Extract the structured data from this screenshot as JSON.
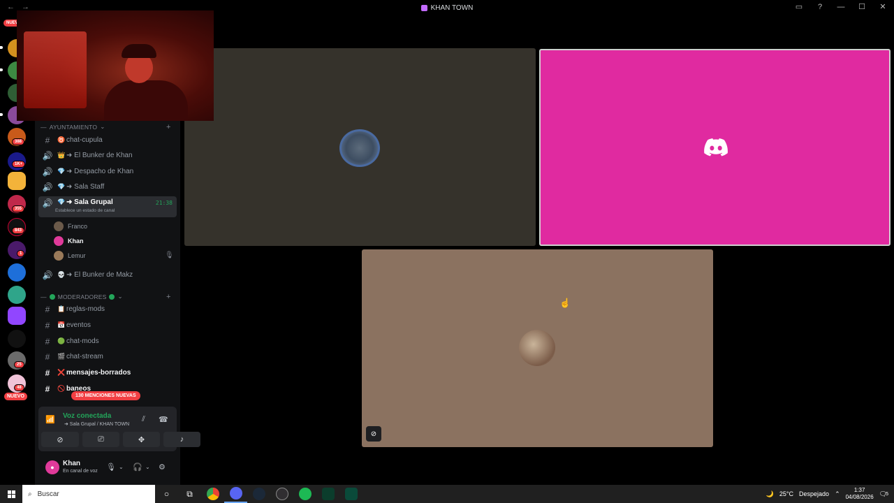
{
  "window": {
    "title": "KHAN TOWN",
    "nav_back": "←",
    "nav_forward": "→"
  },
  "server_rail": {
    "new_badge_top": "NUEVO",
    "new_badge_bottom": "NUEVO",
    "badges": [
      "388",
      "1K+",
      "355",
      "843",
      "1",
      "25",
      "48"
    ]
  },
  "sidebar": {
    "categories": {
      "ayuntamiento": "AYUNTAMIENTO",
      "moderadores": "MODERADORES"
    },
    "channels": [
      {
        "name": "chat-cupula",
        "prefix": "#",
        "emoji": "♉"
      },
      {
        "name": "➜ El Bunker de Khan",
        "prefix": "🔊",
        "emoji": "👑"
      },
      {
        "name": "➜ Despacho de Khan",
        "prefix": "🔊",
        "emoji": "💎"
      },
      {
        "name": "➜ Sala Staff",
        "prefix": "🔊",
        "emoji": "💎"
      },
      {
        "name": "➜ Sala Grupal",
        "prefix": "🔊",
        "emoji": "💎",
        "time": "21:38",
        "status": "Establece un estado de canal"
      },
      {
        "name": "➜ El Bunker de Makz",
        "prefix": "🔊",
        "emoji": "💀"
      },
      {
        "name": "reglas-mods",
        "prefix": "#",
        "emoji": "📋"
      },
      {
        "name": "eventos",
        "prefix": "#",
        "emoji": "📅"
      },
      {
        "name": "chat-mods",
        "prefix": "#",
        "emoji": "🟢"
      },
      {
        "name": "chat-stream",
        "prefix": "#",
        "emoji": "🎬"
      },
      {
        "name": "mensajes-borrados",
        "prefix": "#",
        "emoji": "❌"
      },
      {
        "name": "baneos",
        "prefix": "#",
        "emoji": "🚫"
      }
    ],
    "voice_members": [
      {
        "name": "Franco"
      },
      {
        "name": "Khan"
      },
      {
        "name": "Lemur"
      }
    ],
    "mentions_pill": "130 MENCIONES NUEVAS"
  },
  "voice_panel": {
    "status": "Voz conectada",
    "location": "➜ Sala Grupal / KHAN TOWN"
  },
  "user_panel": {
    "name": "Khan",
    "status": "En canal de voz"
  },
  "taskbar": {
    "search_placeholder": "Buscar",
    "weather": "25°C",
    "weather_desc": "Despejado",
    "time": "1:37",
    "date": "04/08/2026",
    "notifications": "5"
  },
  "colors": {
    "speaking_tile": "#e02aa0",
    "voice_green": "#23a55a",
    "alert_red": "#f23f43"
  }
}
